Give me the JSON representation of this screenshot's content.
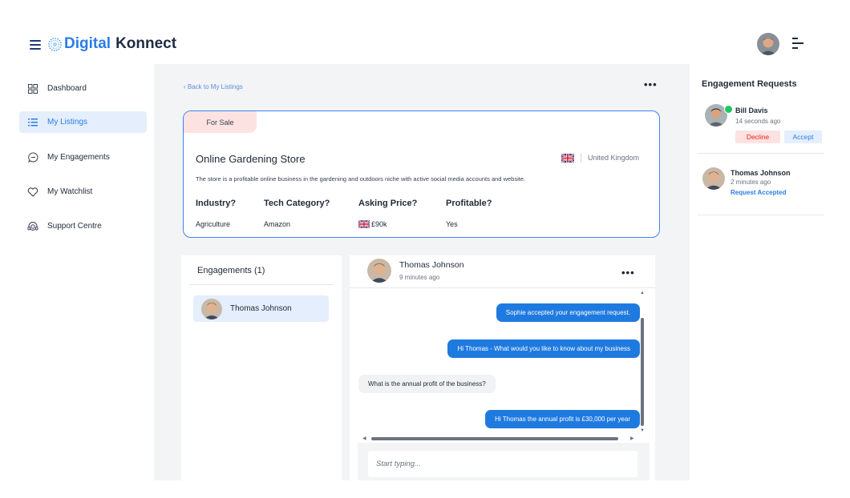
{
  "brand": {
    "word1": "Digital",
    "word2": "Konnect"
  },
  "sidebar": {
    "items": [
      {
        "label": "Dashboard",
        "icon": "grid-icon"
      },
      {
        "label": "My Listings",
        "icon": "list-icon",
        "active": true
      },
      {
        "label": "My Engagements",
        "icon": "chat-icon"
      },
      {
        "label": "My Watchlist",
        "icon": "heart-icon"
      },
      {
        "label": "Support Centre",
        "icon": "headset-icon"
      }
    ]
  },
  "main": {
    "back_link": "‹ Back to My Listings",
    "listing": {
      "badge": "For Sale",
      "title": "Online Gardening Store",
      "country": "United Kingdom",
      "description": "The store is a profitable online business in the gardening and outdoors niche with active social media accounts and website.",
      "columns": [
        {
          "header": "Industry?",
          "value": "Agriculture"
        },
        {
          "header": "Tech Category?",
          "value": "Amazon"
        },
        {
          "header": "Asking Price?",
          "value": "£90k"
        },
        {
          "header": "Profitable?",
          "value": "Yes"
        }
      ]
    },
    "engagements": {
      "header": "Engagements",
      "count": "(1)",
      "items": [
        {
          "name": "Thomas Johnson"
        }
      ]
    },
    "chat": {
      "name": "Thomas Johnson",
      "time": "9 minutes ago",
      "messages": [
        {
          "dir": "out",
          "text": "Sophie accepted your engagement request."
        },
        {
          "dir": "out",
          "text": "Hi Thomas - What would you like to know about my business"
        },
        {
          "dir": "in",
          "text": "What is the annual profit of the business?"
        },
        {
          "dir": "out",
          "text": "Hi Thomas the annual profit is £30,000 per year"
        }
      ],
      "placeholder": "Start typing..."
    }
  },
  "requests": {
    "title": "Engagement Requests",
    "pending": {
      "name": "Bill Davis",
      "time": "14 seconds ago",
      "decline": "Decline",
      "accept": "Accept"
    },
    "accepted": {
      "name": "Thomas Johnson",
      "time": "2 minutes ago",
      "status": "Request Accepted"
    }
  },
  "colors": {
    "accent": "#2b7de9",
    "outgoing_bubble": "#1f7ae0",
    "badge_bg": "#fde2e2",
    "decline_text": "#dc2626",
    "online": "#22c55e"
  }
}
